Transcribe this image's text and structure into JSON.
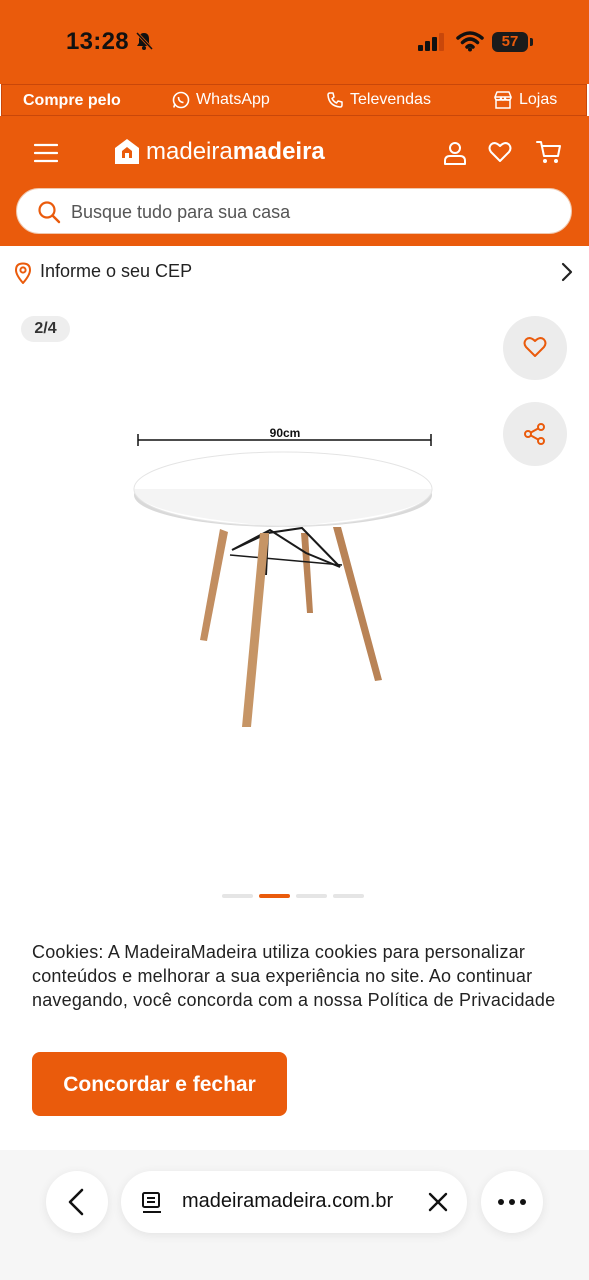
{
  "status_bar": {
    "time": "13:28",
    "battery": "57"
  },
  "contact_bar": {
    "label": "Compre pelo",
    "whatsapp": "WhatsApp",
    "televendas": "Televendas",
    "lojas": "Lojas"
  },
  "header": {
    "logo_light": "madeira",
    "logo_bold": "madeira"
  },
  "search": {
    "placeholder": "Busque tudo para sua casa"
  },
  "cep": {
    "label": "Informe o seu CEP"
  },
  "gallery": {
    "counter": "2/4",
    "dimension_label": "90cm",
    "total_images": 4,
    "active_index": 2
  },
  "cookie": {
    "text": "Cookies: A MadeiraMadeira utiliza cookies para personalizar conteúdos e melhorar a sua experiência no site. Ao continuar navegando, você concorda com a nossa Política de Privacidade",
    "button": "Concordar e fechar"
  },
  "browser": {
    "url": "madeiramadeira.com.br"
  },
  "colors": {
    "brand": "#EA5B0C",
    "text": "#222222"
  }
}
